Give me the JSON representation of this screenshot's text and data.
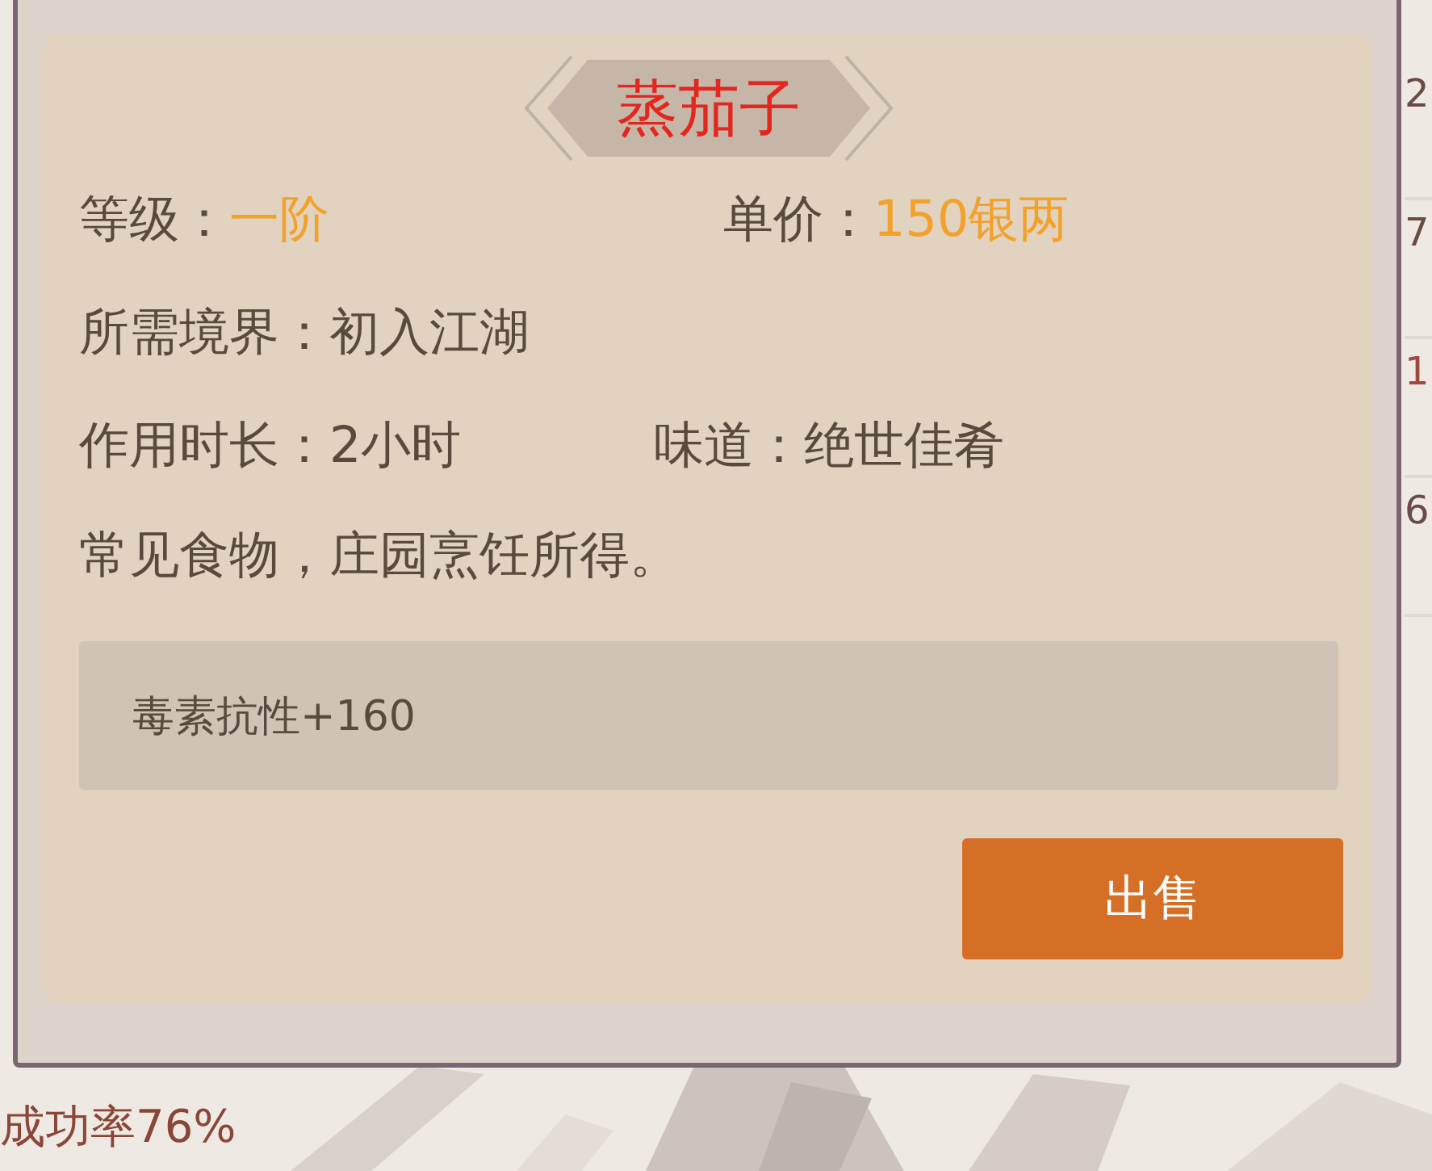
{
  "background": {
    "row_values": [
      {
        "text": "2",
        "kind": "plain"
      },
      {
        "text": "7",
        "kind": "plain"
      },
      {
        "text": "1",
        "kind": "highlight"
      },
      {
        "text": "6",
        "kind": "plain"
      }
    ],
    "footer_text": "成功率76%"
  },
  "dialog": {
    "title": "蒸茄子",
    "fields": [
      {
        "label": "等级：",
        "value": "一阶",
        "kind": "highlight"
      },
      {
        "label": "单价：",
        "value": "150银两",
        "kind": "highlight"
      }
    ],
    "requirement": {
      "label": "所需境界：",
      "value": "初入江湖"
    },
    "details": [
      {
        "label": "作用时长：",
        "value": "2小时"
      },
      {
        "label": "味道：",
        "value": "绝世佳肴"
      }
    ],
    "description": "常见食物，庄园烹饪所得。",
    "effect": "毒素抗性+160",
    "sell_button": "出售"
  }
}
